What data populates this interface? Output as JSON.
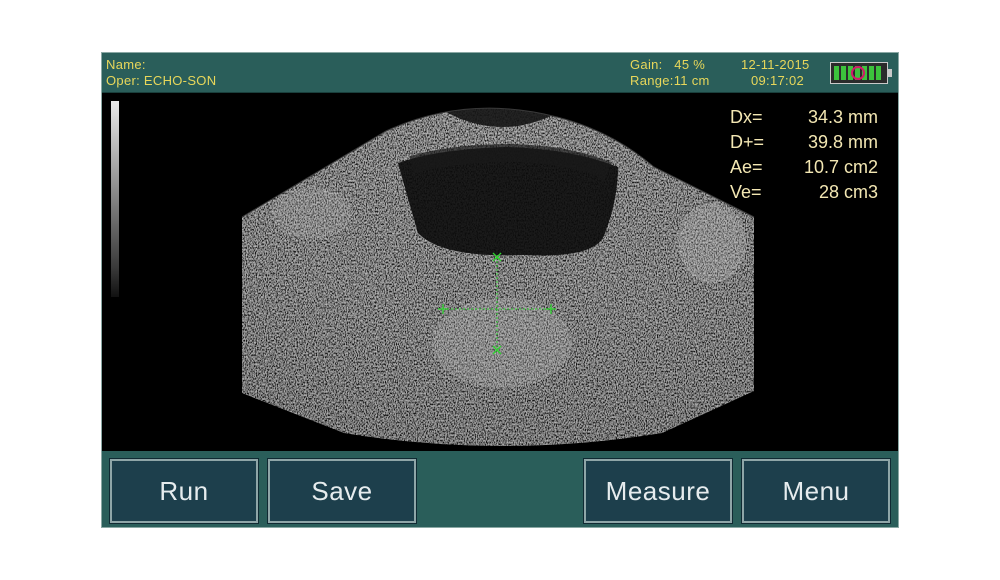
{
  "header": {
    "name_label": "Name:",
    "operator": "Oper: ECHO-SON",
    "gain": "Gain:   45 %",
    "range": "Range:11 cm",
    "date": "12-11-2015",
    "time": "09:17:02"
  },
  "measurements": [
    {
      "label": "Dx=",
      "value": "34.3 mm"
    },
    {
      "label": "D+=",
      "value": "39.8 mm"
    },
    {
      "label": "Ae=",
      "value": "10.7 cm2"
    },
    {
      "label": "Ve=",
      "value": "28 cm3"
    }
  ],
  "buttons": {
    "run": "Run",
    "save": "Save",
    "measure": "Measure",
    "menu": "Menu"
  },
  "colors": {
    "panel": "#2a5e5a",
    "header_text": "#e8d75a",
    "measurement_text": "#f3e7b3",
    "caliper": "#2fd42f",
    "button_bg": "#1d3f4c"
  },
  "icons": {
    "battery": "battery-icon",
    "grayscale": "grayscale-bar"
  }
}
